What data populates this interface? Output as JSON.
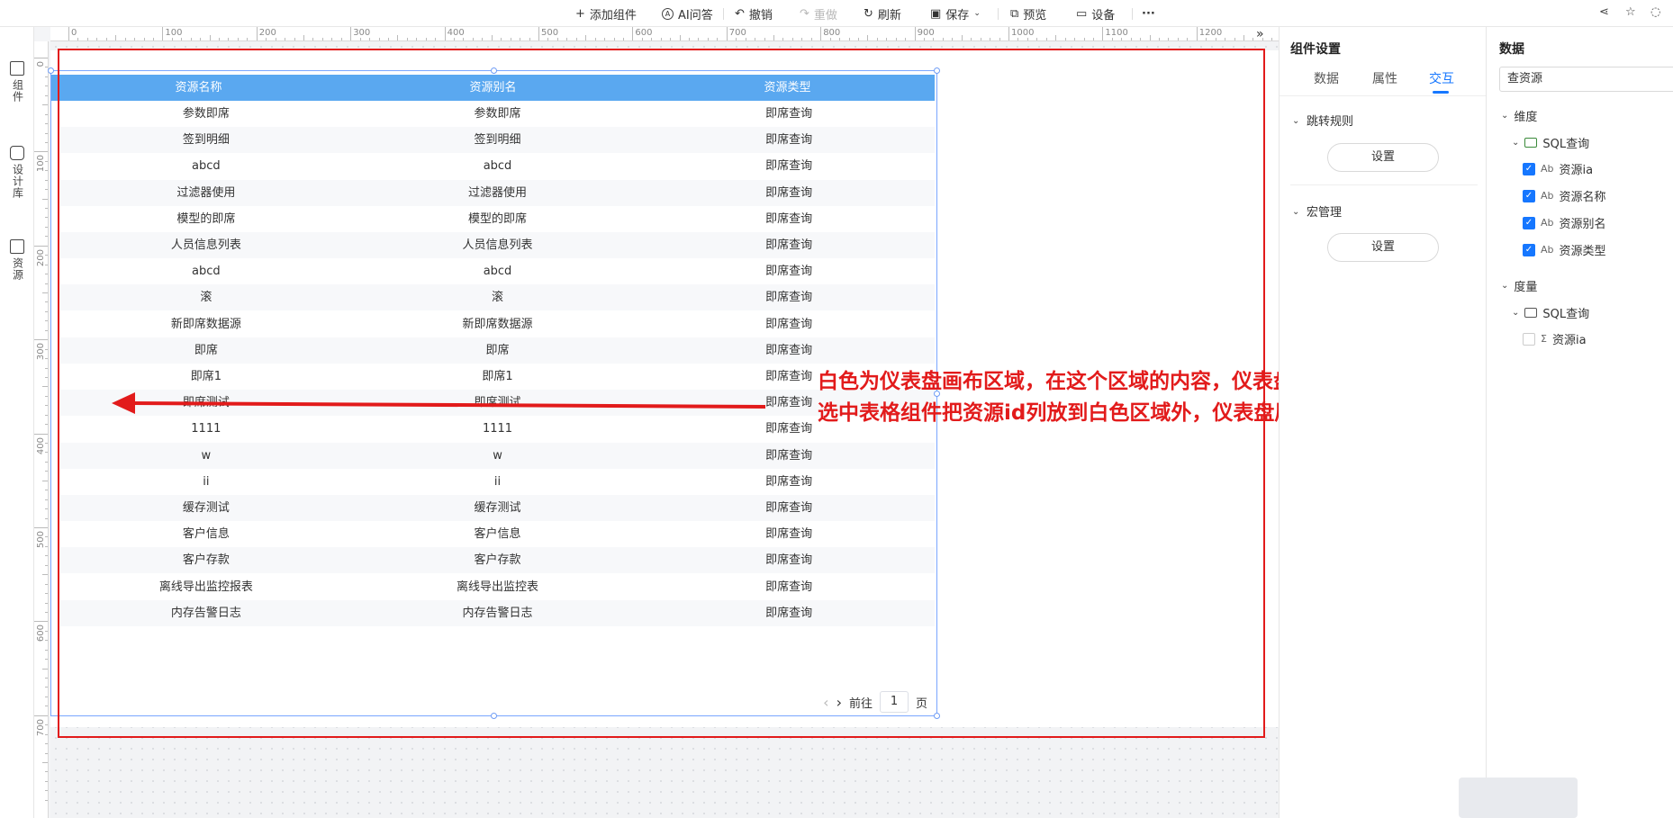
{
  "toolbar": {
    "add_widget": "添加组件",
    "ai_qa": "AI问答",
    "undo": "撤销",
    "redo": "重做",
    "refresh": "刷新",
    "save": "保存",
    "preview": "预览",
    "device": "设备",
    "more": "···"
  },
  "sidenav": {
    "widgets": "组件",
    "design_lib": "设计库",
    "resources": "资源"
  },
  "ruler": {
    "h_labels": [
      "0",
      "100",
      "200",
      "300",
      "400",
      "500",
      "600",
      "700",
      "800",
      "900",
      "1000",
      "1100",
      "1200"
    ],
    "v_labels": [
      "0",
      "100",
      "200",
      "300",
      "400",
      "500",
      "600",
      "700"
    ]
  },
  "table": {
    "columns": [
      "资源名称",
      "资源别名",
      "资源类型"
    ],
    "rows": [
      [
        "参数即席",
        "参数即席",
        "即席查询"
      ],
      [
        "签到明细",
        "签到明细",
        "即席查询"
      ],
      [
        "abcd",
        "abcd",
        "即席查询"
      ],
      [
        "过滤器使用",
        "过滤器使用",
        "即席查询"
      ],
      [
        "模型的即席",
        "模型的即席",
        "即席查询"
      ],
      [
        "人员信息列表",
        "人员信息列表",
        "即席查询"
      ],
      [
        "abcd",
        "abcd",
        "即席查询"
      ],
      [
        "滚",
        "滚",
        "即席查询"
      ],
      [
        "新即席数据源",
        "新即席数据源",
        "即席查询"
      ],
      [
        "即席",
        "即席",
        "即席查询"
      ],
      [
        "即席1",
        "即席1",
        "即席查询"
      ],
      [
        "即席测试",
        "即席测试",
        "即席查询"
      ],
      [
        "1111",
        "1111",
        "即席查询"
      ],
      [
        "w",
        "w",
        "即席查询"
      ],
      [
        "ii",
        "ii",
        "即席查询"
      ],
      [
        "缓存测试",
        "缓存测试",
        "即席查询"
      ],
      [
        "客户信息",
        "客户信息",
        "即席查询"
      ],
      [
        "客户存款",
        "客户存款",
        "即席查询"
      ],
      [
        "离线导出监控报表",
        "离线导出监控表",
        "即席查询"
      ],
      [
        "内存告警日志",
        "内存告警日志",
        "即席查询"
      ]
    ],
    "pager": {
      "prev": "‹",
      "next": "›",
      "goto": "前往",
      "page": "1",
      "unit": "页"
    }
  },
  "annotation": {
    "line1": "白色为仪表盘画布区域，在这个区域的内容，仪表盘展现时会展示出来",
    "line2": "选中表格组件把资源id列放到白色区域外，仪表盘展示时就看不见了",
    "color": "#e21b1b"
  },
  "settings": {
    "title": "组件设置",
    "tabs": [
      "数据",
      "属性",
      "交互"
    ],
    "active_tab": "交互",
    "jump_rules": "跳转规则",
    "macro_mgmt": "宏管理",
    "set_button": "设置"
  },
  "data_panel": {
    "title": "数据",
    "search_value": "查资源",
    "dimension": "维度",
    "sql_query": "SQL查询",
    "dim_fields": [
      {
        "label": "资源ia",
        "checked": true
      },
      {
        "label": "资源名称",
        "checked": true
      },
      {
        "label": "资源别名",
        "checked": true
      },
      {
        "label": "资源类型",
        "checked": true
      }
    ],
    "measure": "度量",
    "measure_fields": [
      {
        "label": "资源ia",
        "checked": false
      }
    ],
    "field_type": "Ab",
    "sum_icon": "Σ"
  },
  "colors": {
    "accent": "#1677ff",
    "table_header": "#5aa8f0",
    "selection": "#7aa6ff"
  }
}
